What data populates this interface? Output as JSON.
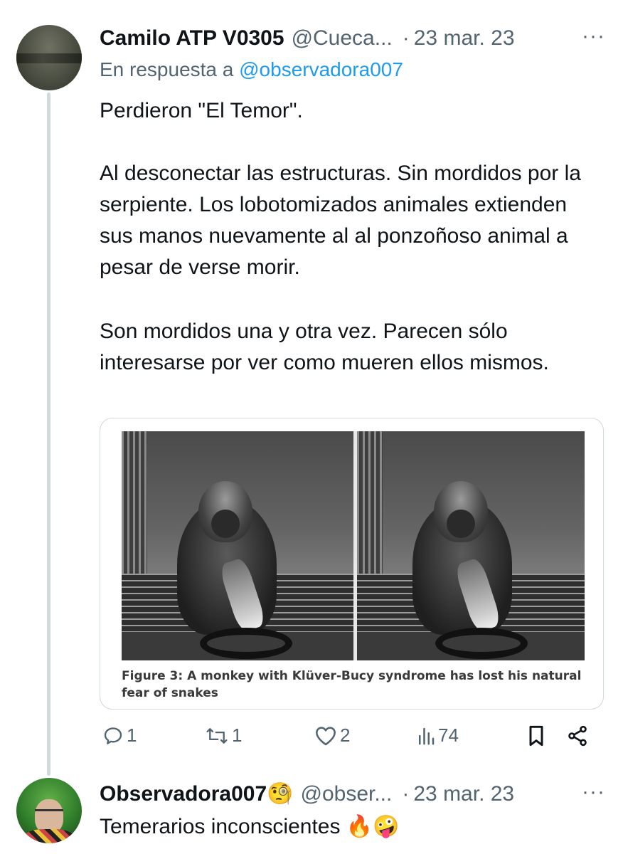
{
  "tweet": {
    "author_name": "Camilo ATP V0305",
    "author_handle": "@Cueca...",
    "dot": "·",
    "date": "23 mar. 23",
    "more_icon": "ellipsis-icon",
    "reply_prefix": "En respuesta a",
    "reply_mention": "@observadora007",
    "paragraphs": [
      "Perdieron \"El Temor\".",
      "Al desconectar las estructuras. Sin mordidos por la serpiente. Los lobotomizados animales extienden sus manos nuevamente al al ponzoñoso animal a pesar de verse morir.",
      "Son mordidos una y otra vez. Parecen sólo interesarse por ver como mueren ellos mismos."
    ],
    "media": {
      "caption": "Figure 3: A monkey with Klüver-Bucy syndrome has lost his natural fear of snakes"
    },
    "actions": {
      "replies": "1",
      "retweets": "1",
      "likes": "2",
      "views": "74"
    },
    "icons": {
      "reply": "reply-bubble-icon",
      "retweet": "retweet-icon",
      "like": "heart-icon",
      "views": "views-bar-chart-icon",
      "bookmark": "bookmark-icon",
      "share": "share-icon"
    }
  },
  "reply": {
    "author_name": "Observadora007🧐",
    "author_handle": "@obser...",
    "dot": "·",
    "date": "23 mar. 23",
    "text": "Temerarios inconscientes 🔥🤪"
  },
  "colors": {
    "text": "#0f1419",
    "secondary": "#536471",
    "link": "#1d9bf0",
    "border": "#cfd9de"
  }
}
